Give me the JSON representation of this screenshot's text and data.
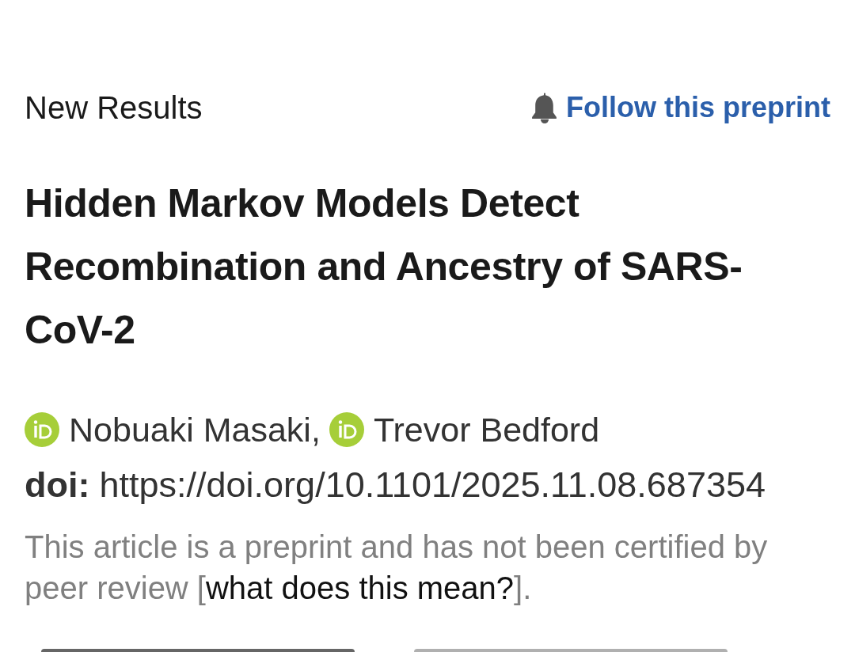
{
  "header": {
    "section_label": "New Results",
    "follow_link": "Follow this preprint"
  },
  "article": {
    "title": "Hidden Markov Models Detect Recombination and Ancestry of SARS-CoV-2",
    "authors": [
      {
        "name": "Nobuaki Masaki,"
      },
      {
        "name": "Trevor Bedford"
      }
    ],
    "doi": {
      "label": "doi:",
      "value": "https://doi.org/10.1101/2025.11.08.687354"
    },
    "disclaimer": {
      "text_before": "This article is a preprint and has not been certified by peer review [",
      "link": "what does this mean?",
      "text_after": "]."
    }
  },
  "bottom_buttons": [
    {
      "kind": "primary"
    },
    {
      "kind": "secondary"
    }
  ]
}
